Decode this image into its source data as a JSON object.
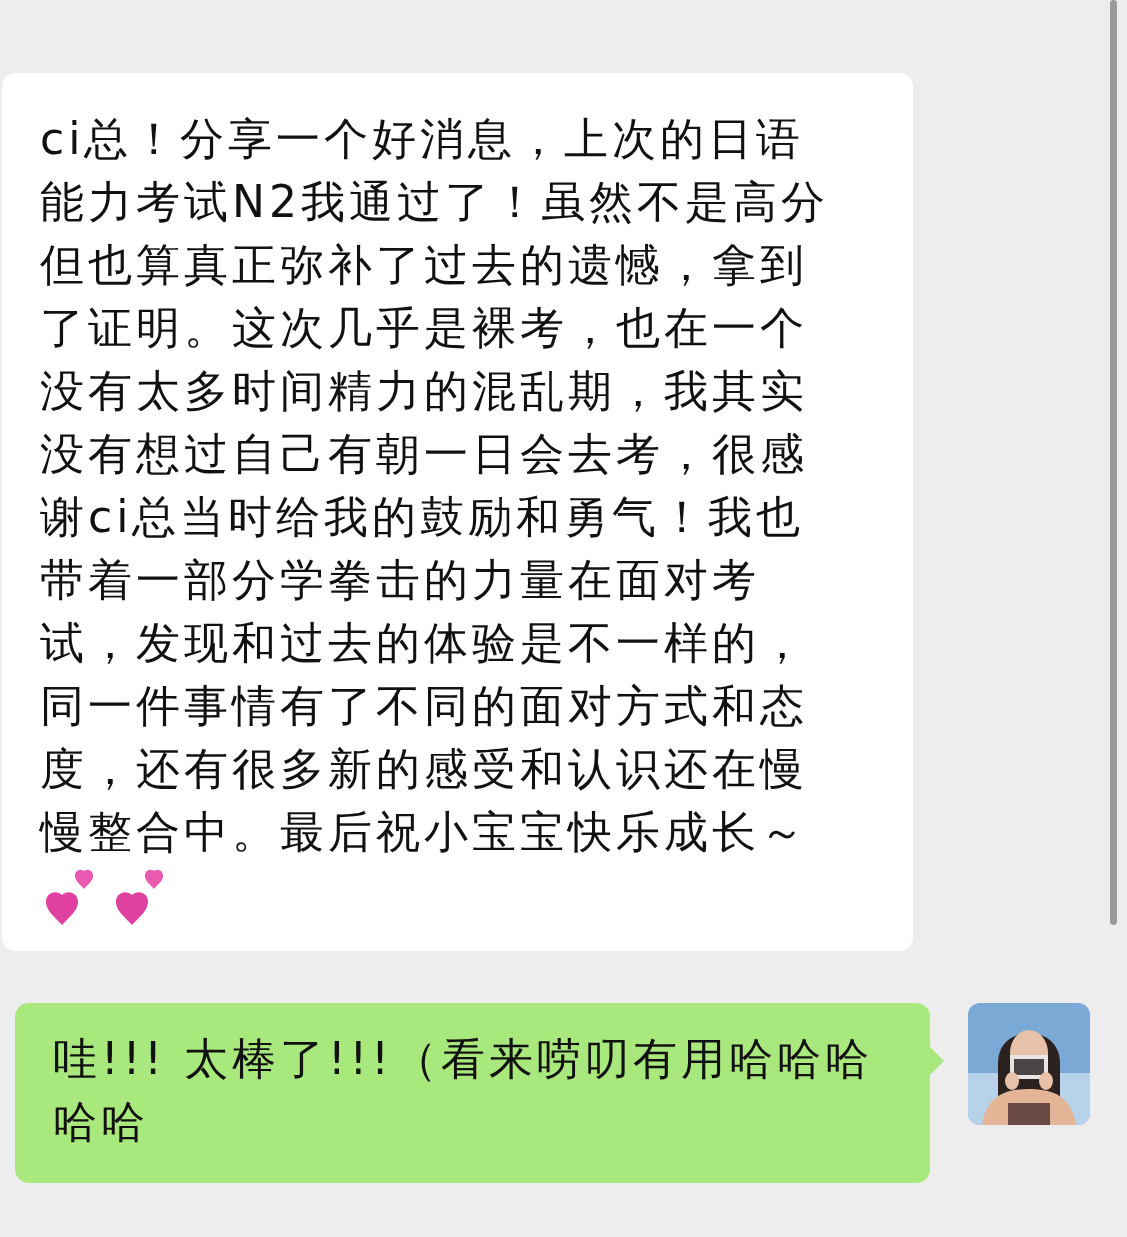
{
  "messages": [
    {
      "kind": "incoming",
      "text": "ci总！分享一个好消息，上次的日语能力考试N2我通过了！虽然不是高分但也算真正弥补了过去的遗憾，拿到了证明。这次几乎是裸考，也在一个没有太多时间精力的混乱期，我其实没有想过自己有朝一日会去考，很感谢ci总当时给我的鼓励和勇气！我也带着一部分学拳击的力量在面对考试，发现和过去的体验是不一样的，同一件事情有了不同的面对方式和态度，还有很多新的感受和认识还在慢慢整合中。最后祝小宝宝快乐成长～",
      "emojis": [
        {
          "kind": "two_hearts"
        },
        {
          "kind": "two_hearts"
        }
      ]
    },
    {
      "kind": "outgoing",
      "text": "哇!!! 太棒了!!!（看来唠叨有用哈哈哈哈哈"
    }
  ]
}
